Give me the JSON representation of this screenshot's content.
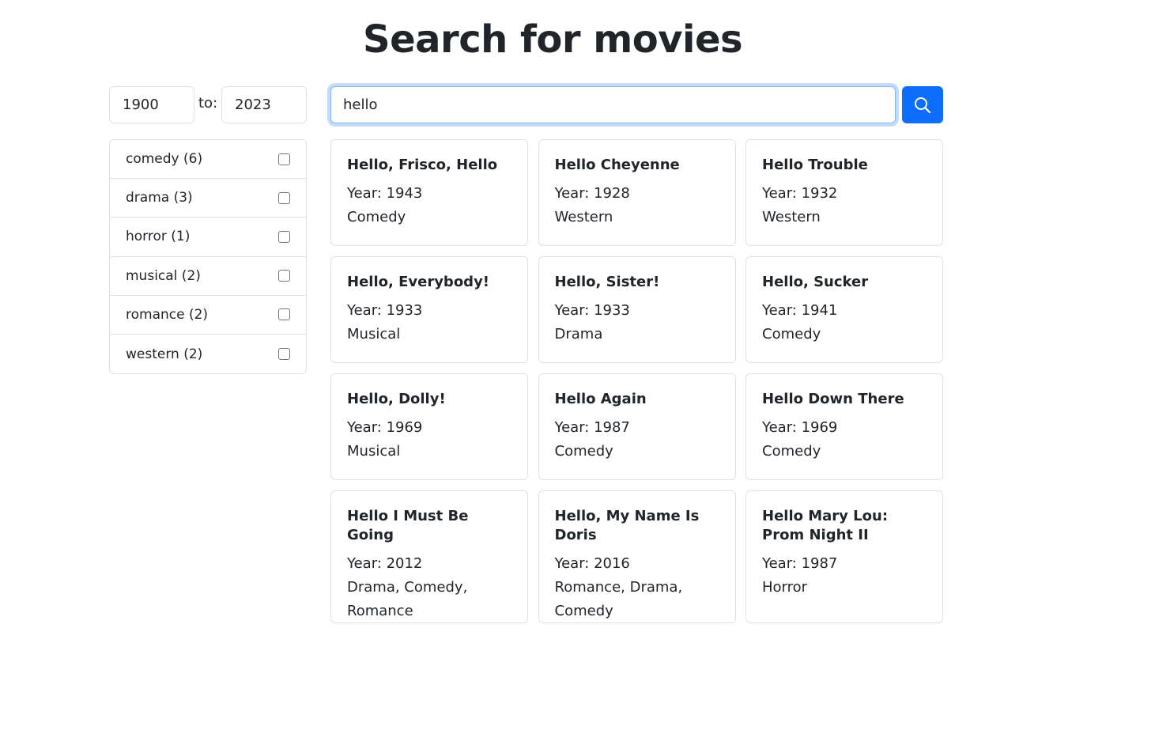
{
  "page": {
    "title": "Search for movies"
  },
  "filters": {
    "year_from": "1900",
    "to_label": "to:",
    "year_to": "2023",
    "genres": [
      {
        "label": "comedy (6)",
        "checked": false
      },
      {
        "label": "drama (3)",
        "checked": false
      },
      {
        "label": "horror (1)",
        "checked": false
      },
      {
        "label": "musical (2)",
        "checked": false
      },
      {
        "label": "romance (2)",
        "checked": false
      },
      {
        "label": "western (2)",
        "checked": false
      }
    ]
  },
  "search": {
    "value": "hello",
    "button_icon": "search-icon"
  },
  "results": [
    {
      "title": "Hello, Frisco, Hello",
      "year": "Year: 1943",
      "genres": "Comedy"
    },
    {
      "title": "Hello Cheyenne",
      "year": "Year: 1928",
      "genres": "Western"
    },
    {
      "title": "Hello Trouble",
      "year": "Year: 1932",
      "genres": "Western"
    },
    {
      "title": "Hello, Everybody!",
      "year": "Year: 1933",
      "genres": "Musical"
    },
    {
      "title": "Hello, Sister!",
      "year": "Year: 1933",
      "genres": "Drama"
    },
    {
      "title": "Hello, Sucker",
      "year": "Year: 1941",
      "genres": "Comedy"
    },
    {
      "title": "Hello, Dolly!",
      "year": "Year: 1969",
      "genres": "Musical"
    },
    {
      "title": "Hello Again",
      "year": "Year: 1987",
      "genres": "Comedy"
    },
    {
      "title": "Hello Down There",
      "year": "Year: 1969",
      "genres": "Comedy"
    },
    {
      "title": "Hello I Must Be Going",
      "year": "Year: 2012",
      "genres": "Drama, Comedy, Romance"
    },
    {
      "title": "Hello, My Name Is Doris",
      "year": "Year: 2016",
      "genres": "Romance, Drama, Comedy"
    },
    {
      "title": "Hello Mary Lou: Prom Night II",
      "year": "Year: 1987",
      "genres": "Horror"
    }
  ],
  "colors": {
    "primary": "#0d6efd",
    "border": "#dee2e6",
    "text": "#212529"
  }
}
